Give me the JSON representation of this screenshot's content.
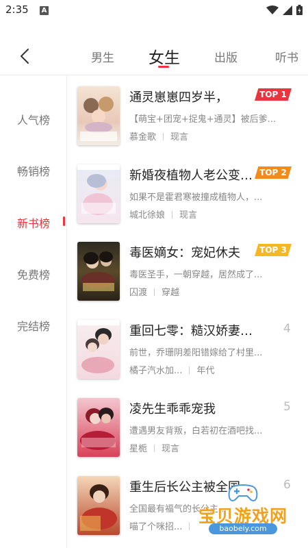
{
  "status_bar": {
    "time": "2:35",
    "notification_glyph": "A"
  },
  "tabs": [
    {
      "label": "男生"
    },
    {
      "label": "女生",
      "active": true
    },
    {
      "label": "出版"
    },
    {
      "label": "听书"
    }
  ],
  "side_nav": [
    {
      "label": "人气榜"
    },
    {
      "label": "畅销榜"
    },
    {
      "label": "新书榜",
      "active": true
    },
    {
      "label": "免费榜"
    },
    {
      "label": "完结榜"
    }
  ],
  "books": [
    {
      "title": "通灵崽崽四岁半，",
      "rank": "TOP 1",
      "desc": "【萌宝+团宠+捉鬼+通灵】被后爹...",
      "author": "慕金歌",
      "genre": "现言",
      "cover_text": "通灵崽崽四岁半"
    },
    {
      "title": "新婚夜植物人老公变傻了",
      "rank": "TOP 2",
      "desc": "如果不是霍君寒被撞成植物人，...",
      "author": "城北徐娘",
      "genre": "现言",
      "cover_text": "植物人老公变傻了"
    },
    {
      "title": "毒医嫡女：宠妃休夫",
      "rank": "TOP 3",
      "desc": "毒医圣手，一朝穿越，居然成了...",
      "author": "囚渡",
      "genre": "穿越",
      "cover_text": "宠妃休夫"
    },
    {
      "title": "重回七零：糙汉娇妻软又甜",
      "rank": "4",
      "desc": "前世，乔珊阴差阳错嫁给了村里...",
      "author": "橘子汽水加...",
      "genre": "年代",
      "cover_text": "糙汉娇妻软又甜"
    },
    {
      "title": "凌先生乖乖宠我",
      "rank": "5",
      "desc": "遭遇男友背叛，白若初在酒吧找...",
      "author": "星栀",
      "genre": "现言",
      "cover_text": "凌先生乖乖宠我"
    },
    {
      "title": "重生后长公主被全国团宠了",
      "rank": "6",
      "desc": "全国最有福气的长公主...",
      "author": "喵了个咪招...",
      "genre": "",
      "cover_text": "长公主被全国团宠"
    }
  ],
  "colors": {
    "accent": "#e8353e",
    "top1": "#e8353e",
    "top2": "#f28a1c",
    "top3": "#f5b822"
  },
  "watermark": {
    "text": "宝贝游戏网",
    "url": "baobeiy.com"
  }
}
